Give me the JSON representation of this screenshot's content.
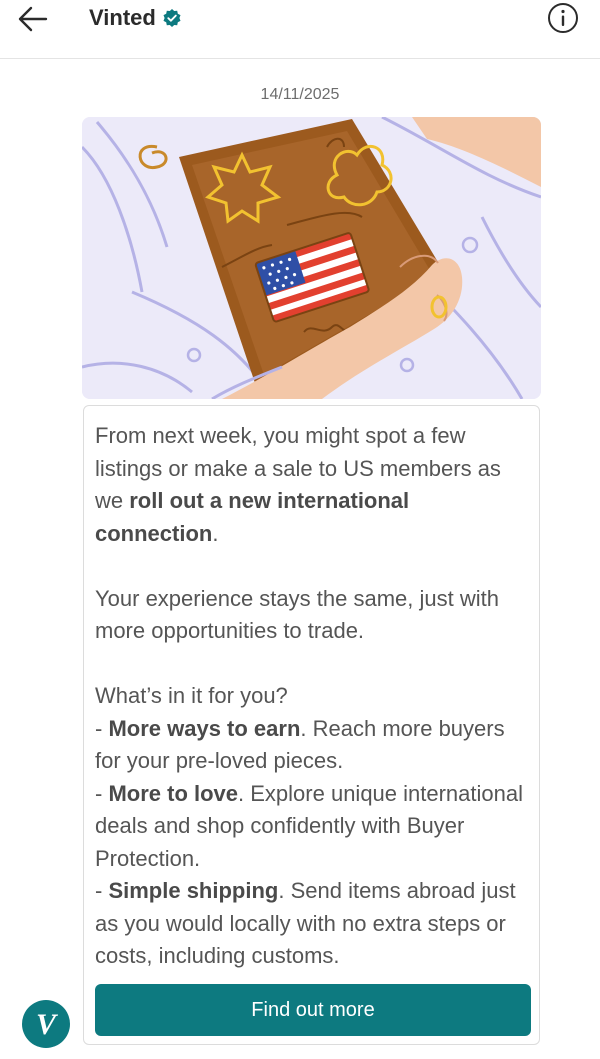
{
  "header": {
    "back_icon": "arrow-left-icon",
    "title": "Vinted",
    "verified_icon": "verified-badge-icon",
    "info_icon": "info-icon"
  },
  "conversation": {
    "date": "14/11/2025",
    "illustration": "hands-holding-package-with-us-flag",
    "message": {
      "p1_a": "From next week, you might spot a few listings or make a sale to US members as we ",
      "p1_bold": "roll out a new international connection",
      "p1_c": ".",
      "p2": "Your experience stays the same, just with more opportunities to trade.",
      "p3_heading": "What’s in it for you?",
      "b1_prefix": "- ",
      "b1_bold": "More ways to earn",
      "b1_text": ". Reach more buyers for your pre-loved pieces.",
      "b2_prefix": "- ",
      "b2_bold": "More to love",
      "b2_text": ". Explore unique international deals and shop confidently with Buyer Protection.",
      "b3_prefix": "- ",
      "b3_bold": "Simple shipping",
      "b3_text": ". Send items abroad just as you would locally with no extra steps or costs, including customs."
    },
    "cta_label": "Find out more",
    "sender_avatar_letter": "V"
  },
  "colors": {
    "brand": "#0d7a80",
    "illustration_bg": "#eceaf9"
  }
}
